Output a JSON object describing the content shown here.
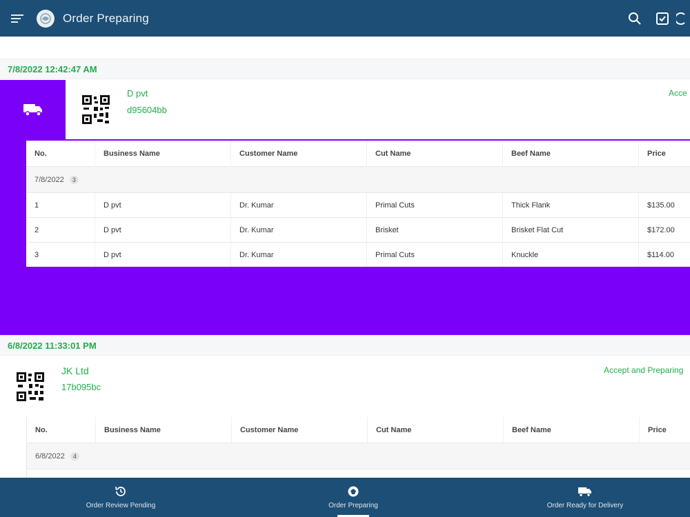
{
  "appbar": {
    "title": "Order Preparing"
  },
  "icons": {
    "menu": "menu-icon",
    "logo": "app-logo-icon",
    "search": "search-icon",
    "checklist": "checkbox-icon",
    "more": "refresh-icon",
    "truck": "truck-icon",
    "qr": "qr-code-icon"
  },
  "colors": {
    "primary": "#1c4e76",
    "accent_green": "#1fae4b",
    "selected_purple": "#7b00f7"
  },
  "table_headers": [
    "No.",
    "Business Name",
    "Customer Name",
    "Cut Name",
    "Beef Name",
    "Price"
  ],
  "orders": [
    {
      "date": "7/8/2022 12:42:47 AM",
      "business": "D pvt",
      "code": "d95604bb",
      "status": "Acce",
      "group_date": "7/8/2022",
      "group_count": "3",
      "rows": [
        [
          "1",
          "D pvt",
          "Dr. Kumar",
          "Primal Cuts",
          "Thick Flank",
          "$135.00"
        ],
        [
          "2",
          "D pvt",
          "Dr. Kumar",
          "Brisket",
          "Brisket Flat Cut",
          "$172.00"
        ],
        [
          "3",
          "D pvt",
          "Dr. Kumar",
          "Primal Cuts",
          "Knuckle",
          "$114.00"
        ]
      ]
    },
    {
      "date": "6/8/2022 11:33:01 PM",
      "business": "JK Ltd",
      "code": "17b095bc",
      "status": "Accept and Preparing",
      "group_date": "6/8/2022",
      "group_count": "4"
    }
  ],
  "bottom_nav": [
    {
      "label": "Order Review Pending"
    },
    {
      "label": "Order Preparing"
    },
    {
      "label": "Order Ready for Delivery"
    }
  ]
}
